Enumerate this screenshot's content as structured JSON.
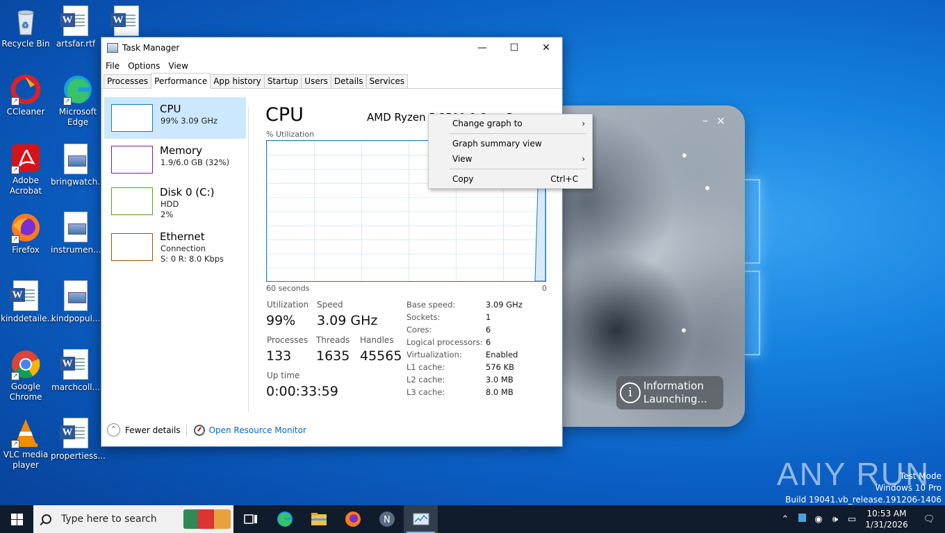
{
  "desktop": {
    "icons": [
      {
        "label": "Recycle Bin",
        "icon": "recycle-bin-icon"
      },
      {
        "label": "artsfar.rtf",
        "icon": "word-document-icon"
      },
      {
        "label": "",
        "icon": "word-document-icon"
      },
      {
        "label": "CCleaner",
        "icon": "ccleaner-icon"
      },
      {
        "label": "Microsoft Edge",
        "icon": "edge-icon"
      },
      {
        "label": "Adobe Acrobat",
        "icon": "acrobat-icon"
      },
      {
        "label": "bringwatch...",
        "icon": "image-file-icon"
      },
      {
        "label": "Firefox",
        "icon": "firefox-icon"
      },
      {
        "label": "instrumen...",
        "icon": "image-file-icon"
      },
      {
        "label": "kinddetaile...",
        "icon": "word-document-icon"
      },
      {
        "label": "kindpopul...",
        "icon": "image-file-icon"
      },
      {
        "label": "Google Chrome",
        "icon": "chrome-icon"
      },
      {
        "label": "marchcoll...",
        "icon": "word-document-icon"
      },
      {
        "label": "VLC media player",
        "icon": "vlc-icon"
      },
      {
        "label": "propertiess...",
        "icon": "word-document-icon"
      }
    ]
  },
  "taskmanager": {
    "title": "Task Manager",
    "menu": [
      "File",
      "Options",
      "View"
    ],
    "tabs": [
      "Processes",
      "Performance",
      "App history",
      "Startup",
      "Users",
      "Details",
      "Services"
    ],
    "active_tab": "Performance",
    "sidebar": [
      {
        "title": "CPU",
        "line1": "99%  3.09 GHz",
        "line2": "",
        "color": "#117dbb"
      },
      {
        "title": "Memory",
        "line1": "1.9/6.0 GB (32%)",
        "line2": "",
        "color": "#8b12ae"
      },
      {
        "title": "Disk 0 (C:)",
        "line1": "HDD",
        "line2": "2%",
        "color": "#4da60c"
      },
      {
        "title": "Ethernet",
        "line1": "Connection",
        "line2": "S: 0  R: 8.0 Kbps",
        "color": "#a74f01"
      }
    ],
    "main": {
      "title": "CPU",
      "cpu_name": "AMD Ryzen 5 3500 6-Core Processor",
      "util_label": "% Utilization",
      "graph_left_label": "60 seconds",
      "graph_right_label": "0",
      "utilization_label": "Utilization",
      "utilization": "99%",
      "speed_label": "Speed",
      "speed": "3.09 GHz",
      "processes_label": "Processes",
      "processes": "133",
      "threads_label": "Threads",
      "threads": "1635",
      "handles_label": "Handles",
      "handles": "45565",
      "uptime_label": "Up time",
      "uptime": "0:00:33:59",
      "specs": [
        {
          "k": "Base speed:",
          "v": "3.09 GHz"
        },
        {
          "k": "Sockets:",
          "v": "1"
        },
        {
          "k": "Cores:",
          "v": "6"
        },
        {
          "k": "Logical processors:",
          "v": "6"
        },
        {
          "k": "Virtualization:",
          "v": "Enabled"
        },
        {
          "k": "L1 cache:",
          "v": "576 KB"
        },
        {
          "k": "L2 cache:",
          "v": "3.0 MB"
        },
        {
          "k": "L3 cache:",
          "v": "8.0 MB"
        }
      ]
    },
    "footer": {
      "fewer_details": "Fewer details",
      "resource_monitor": "Open Resource Monitor"
    }
  },
  "context_menu": {
    "items": [
      {
        "label": "Change graph to",
        "submenu": true,
        "shortcut": ""
      },
      {
        "label": "Graph summary view",
        "submenu": false,
        "shortcut": ""
      },
      {
        "label": "View",
        "submenu": true,
        "shortcut": ""
      },
      {
        "label": "Copy",
        "submenu": false,
        "shortcut": "Ctrl+C"
      }
    ]
  },
  "launch_window": {
    "line1": "Information",
    "line2": "Launching..."
  },
  "watermark": "ANY RUN",
  "test_mode": {
    "line1": "Test Mode",
    "line2": "Windows 10 Pro",
    "line3": "Build 19041.vb_release.191206-1406"
  },
  "taskbar": {
    "search_placeholder": "Type here to search",
    "time": "10:53 AM",
    "date": "1/31/2026"
  }
}
